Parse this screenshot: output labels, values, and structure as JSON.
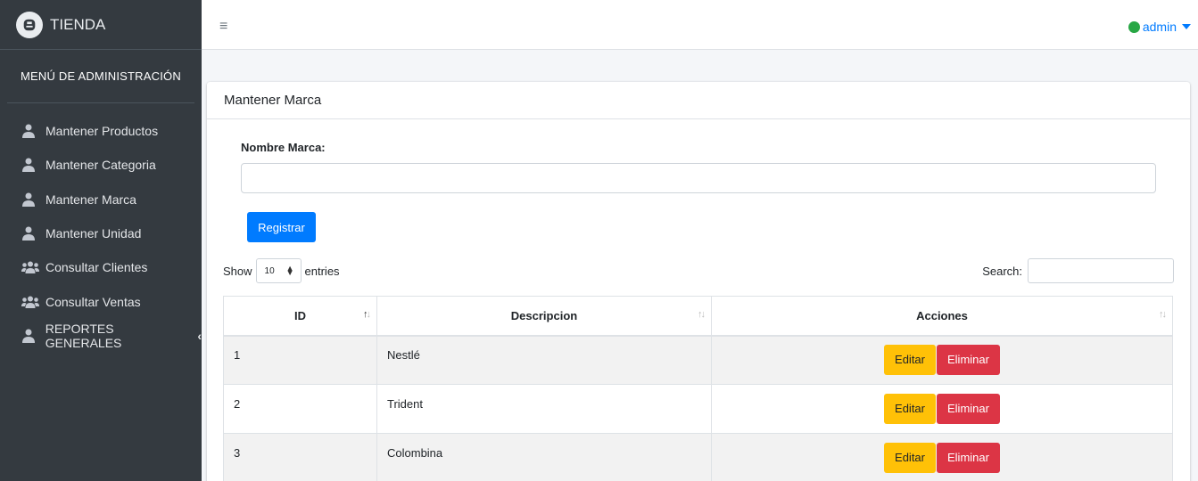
{
  "brand": {
    "name": "TIENDA"
  },
  "sidebar": {
    "header": "MENÚ DE ADMINISTRACIÓN",
    "items": [
      {
        "label": "Mantener Productos",
        "icon": "user-tie-icon"
      },
      {
        "label": "Mantener Categoria",
        "icon": "user-tie-icon"
      },
      {
        "label": "Mantener Marca",
        "icon": "user-tie-icon"
      },
      {
        "label": "Mantener Unidad",
        "icon": "user-tie-icon"
      },
      {
        "label": "Consultar Clientes",
        "icon": "users-icon"
      },
      {
        "label": "Consultar Ventas",
        "icon": "users-icon"
      },
      {
        "label": "REPORTES GENERALES",
        "icon": "user-tie-icon",
        "chevron": "‹"
      }
    ]
  },
  "topbar": {
    "menu_icon": "≡",
    "user": "admin",
    "status_color": "#28a745"
  },
  "card": {
    "title": "Mantener Marca",
    "form": {
      "label": "Nombre Marca:",
      "value": "",
      "button": "Registrar"
    }
  },
  "datatable": {
    "show_label": "Show",
    "entries_label": "entries",
    "page_length": "10",
    "search_label": "Search:",
    "search_value": "",
    "columns": [
      "ID",
      "Descripcion",
      "Acciones"
    ],
    "rows": [
      {
        "id": "1",
        "descripcion": "Nestlé"
      },
      {
        "id": "2",
        "descripcion": "Trident"
      },
      {
        "id": "3",
        "descripcion": "Colombina"
      }
    ],
    "edit_label": "Editar",
    "delete_label": "Eliminar"
  },
  "colors": {
    "sidebar_bg": "#343a40",
    "primary": "#007bff",
    "warning": "#ffc107",
    "danger": "#dc3545",
    "success": "#28a745"
  }
}
